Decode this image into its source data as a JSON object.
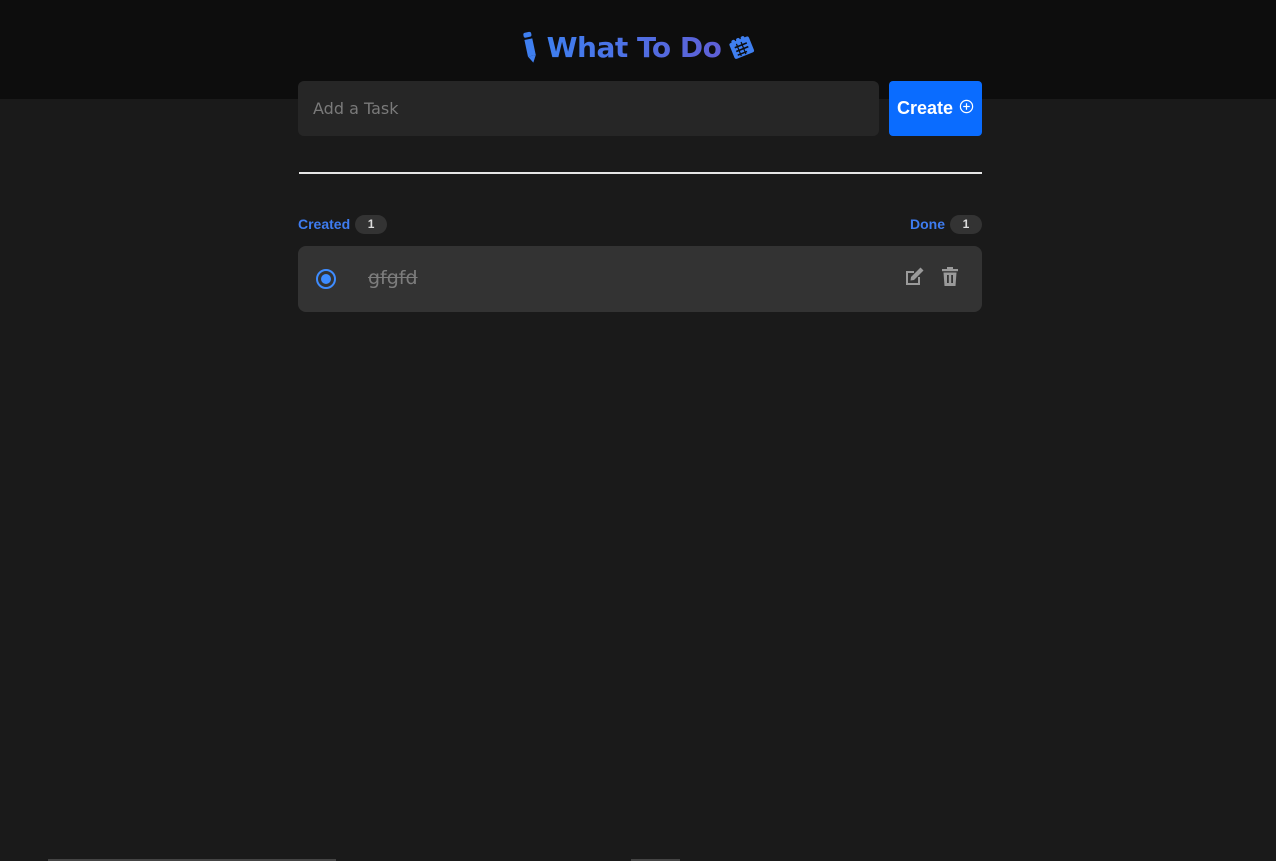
{
  "header": {
    "title": "What To Do",
    "left_icon": "pencil-icon",
    "right_icon": "notepad-icon"
  },
  "new_task": {
    "placeholder": "Add a Task",
    "value": "",
    "create_label": "Create",
    "create_icon": "plus-circle-icon"
  },
  "counters": {
    "created_label": "Created",
    "created_count": "1",
    "done_label": "Done",
    "done_count": "1"
  },
  "tasks": [
    {
      "text": "gfgfd",
      "done": true,
      "edit_icon": "edit-icon",
      "delete_icon": "trash-icon"
    }
  ],
  "colors": {
    "accent": "#0a6cff",
    "title_blue": "#3f7ff0",
    "background": "#1a1a1a",
    "header_bg": "#0d0d0d",
    "card_bg": "#333333"
  }
}
